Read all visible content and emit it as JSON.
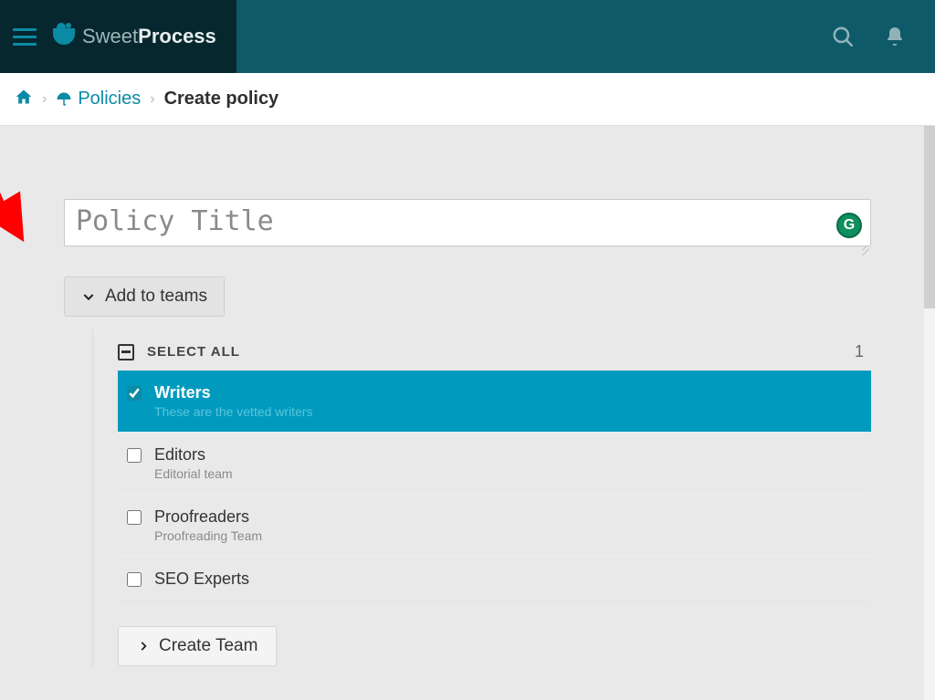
{
  "header": {
    "brand_light": "Sweet",
    "brand_bold": "Process"
  },
  "breadcrumb": {
    "policies_label": "Policies",
    "current": "Create policy"
  },
  "title": {
    "placeholder": "Policy Title",
    "value": "",
    "grammarly_badge": "G"
  },
  "teams_section": {
    "toggle_label": "Add to teams",
    "select_all_label": "SELECT ALL",
    "selected_count": "1",
    "teams": [
      {
        "name": "Writers",
        "description": "These are the vetted writers",
        "checked": true
      },
      {
        "name": "Editors",
        "description": "Editorial team",
        "checked": false
      },
      {
        "name": "Proofreaders",
        "description": "Proofreading Team",
        "checked": false
      },
      {
        "name": "SEO Experts",
        "description": "",
        "checked": false
      }
    ],
    "create_team_label": "Create Team"
  }
}
